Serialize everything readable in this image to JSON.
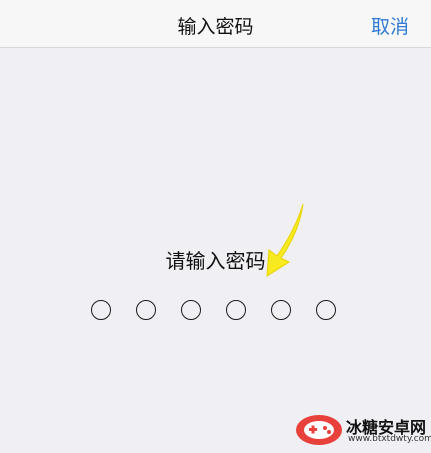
{
  "nav": {
    "title": "输入密码",
    "cancel_label": "取消"
  },
  "passcode": {
    "prompt": "请输入密码",
    "digit_count": 6,
    "filled_count": 0
  },
  "annotation": {
    "color": "#f7ea1f",
    "icon": "yellow-arrow"
  },
  "watermark": {
    "site_name": "冰糖安卓网",
    "url": "www.btxtdwty.com"
  },
  "colors": {
    "accent": "#2f7bd6",
    "background": "#efeff4",
    "nav_background": "#f7f7f8"
  }
}
